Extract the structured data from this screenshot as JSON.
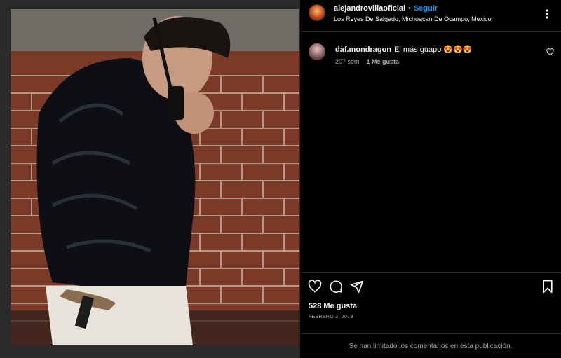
{
  "post": {
    "author": "alejandrovillaoficial",
    "separator": "•",
    "follow_label": "Seguir",
    "location": "Los Reyes De Salgado, Michoacan De Ocampo, Mexico"
  },
  "comments": [
    {
      "username": "daf.mondragon",
      "text": "El más guapo 😍😍😍",
      "age": "207 sem",
      "likes": "1 Me gusta"
    }
  ],
  "stats": {
    "likes": "528 Me gusta",
    "date": "FEBRERO 3, 2019"
  },
  "footer": {
    "comments_limited": "Se han limitado los comentarios en esta publicación."
  },
  "icons": [
    "more-icon",
    "like-icon",
    "comment-icon",
    "share-icon",
    "save-icon"
  ],
  "colors": {
    "follow": "#0095f6",
    "background": "#000000",
    "muted": "#a8a8a8"
  }
}
